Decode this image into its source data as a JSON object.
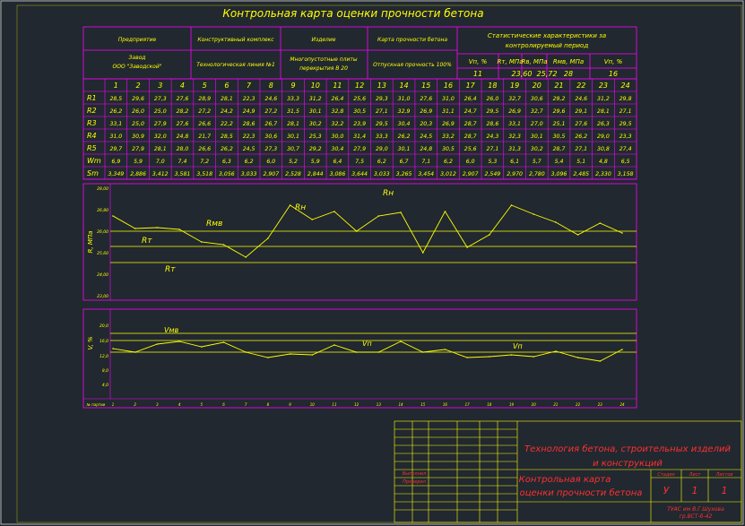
{
  "title": "Контрольная карта оценки прочности бетона",
  "header": {
    "enterprise_label": "Предприятие",
    "enterprise_value_1": "Завод",
    "enterprise_value_2": "ООО \"Заводской\"",
    "structure_label": "Конструктивный комплекс",
    "structure_value": "Технологическая линия №1",
    "product_label": "Изделие",
    "product_value_1": "Многопустотные плиты",
    "product_value_2": "перекрытия В 20",
    "strength_label": "Карта прочности бетона",
    "strength_value": "Отпускная прочность 100%",
    "stat_label_1": "Статистические характеристики за",
    "stat_label_2": "контролируемый период",
    "stat_cols": [
      "Vп, %",
      "Rт, МПа",
      "Rв, МПа",
      "Rмв, МПа",
      "Vп, %"
    ],
    "stat_values": [
      "11",
      "23,60",
      "25,72",
      "28",
      "16"
    ]
  },
  "table": {
    "columns": [
      "1",
      "2",
      "3",
      "4",
      "5",
      "6",
      "7",
      "8",
      "9",
      "10",
      "11",
      "12",
      "13",
      "14",
      "15",
      "16",
      "17",
      "18",
      "19",
      "20",
      "21",
      "22",
      "23",
      "24"
    ],
    "rows": [
      {
        "label": "R1",
        "values": [
          "28,5",
          "29,6",
          "27,3",
          "27,6",
          "28,9",
          "28,1",
          "22,3",
          "24,6",
          "33,3",
          "31,2",
          "26,4",
          "25,6",
          "29,3",
          "31,0",
          "27,6",
          "31,0",
          "26,4",
          "26,0",
          "32,7",
          "30,6",
          "29,2",
          "24,6",
          "31,2",
          "29,8"
        ]
      },
      {
        "label": "R2",
        "values": [
          "26,2",
          "26,0",
          "25,0",
          "28,2",
          "27,2",
          "24,2",
          "24,9",
          "27,2",
          "31,5",
          "30,1",
          "32,8",
          "30,5",
          "27,1",
          "32,9",
          "26,9",
          "31,1",
          "24,7",
          "29,5",
          "26,9",
          "32,7",
          "29,6",
          "29,1",
          "28,1",
          "27,1"
        ]
      },
      {
        "label": "R3",
        "values": [
          "33,1",
          "25,0",
          "27,9",
          "27,6",
          "26,6",
          "22,2",
          "28,6",
          "26,7",
          "28,1",
          "30,2",
          "32,2",
          "23,9",
          "29,5",
          "30,4",
          "20,3",
          "26,9",
          "28,7",
          "28,6",
          "33,1",
          "27,0",
          "25,1",
          "27,6",
          "26,3",
          "29,5"
        ]
      },
      {
        "label": "R4",
        "values": [
          "31,0",
          "30,9",
          "32,0",
          "24,8",
          "21,7",
          "28,5",
          "22,3",
          "30,6",
          "30,1",
          "25,3",
          "30,0",
          "31,4",
          "33,3",
          "26,2",
          "24,5",
          "33,2",
          "28,7",
          "24,3",
          "32,3",
          "30,1",
          "30,5",
          "26,2",
          "29,0",
          "23,3"
        ]
      },
      {
        "label": "R5",
        "values": [
          "29,7",
          "27,9",
          "28,1",
          "28,0",
          "26,6",
          "26,2",
          "24,5",
          "27,3",
          "30,7",
          "29,2",
          "30,4",
          "27,9",
          "29,0",
          "30,1",
          "24,8",
          "30,5",
          "25,6",
          "27,1",
          "31,3",
          "30,2",
          "28,7",
          "27,1",
          "30,8",
          "27,4"
        ]
      },
      {
        "label": "Wm",
        "values": [
          "6,9",
          "5,9",
          "7,0",
          "7,4",
          "7,2",
          "6,3",
          "6,2",
          "6,0",
          "5,2",
          "5,9",
          "6,4",
          "7,5",
          "6,2",
          "6,7",
          "7,1",
          "6,2",
          "6,0",
          "5,3",
          "6,1",
          "5,7",
          "5,4",
          "5,1",
          "4,8",
          "6,5"
        ]
      },
      {
        "label": "Sm",
        "values": [
          "3,349",
          "2,886",
          "3,412",
          "3,581",
          "3,518",
          "3,056",
          "3,033",
          "2,907",
          "2,528",
          "2,844",
          "3,086",
          "3,644",
          "3,033",
          "3,265",
          "3,454",
          "3,012",
          "2,907",
          "2,549",
          "2,970",
          "2,780",
          "3,096",
          "2,485",
          "2,330",
          "3,158"
        ]
      }
    ]
  },
  "chart_r": {
    "ylabel": "R, МПа",
    "ticks": [
      "28,00",
      "26,80",
      "26,00",
      "25,60",
      "24,00",
      "23,00"
    ],
    "label_rmv": "Rмв",
    "label_rt_upper": "Rт",
    "label_rt_lower": "Rт",
    "label_rn": "Rн",
    "label_rn2": "Rн"
  },
  "chart_v": {
    "ylabel": "V, %",
    "ticks": [
      "20,0",
      "16,0",
      "12,0",
      "8,0",
      "4,0"
    ],
    "label_vmv": "Vмв",
    "label_vn": "Vп",
    "label_vn2": "Vп",
    "xaxis_label": "№ партии",
    "xticks": [
      "1",
      "2",
      "3",
      "4",
      "5",
      "6",
      "7",
      "8",
      "9",
      "10",
      "11",
      "12",
      "13",
      "14",
      "15",
      "16",
      "17",
      "18",
      "19",
      "20",
      "21",
      "22",
      "23",
      "24"
    ]
  },
  "chart_data": [
    {
      "type": "line",
      "title": "",
      "ylabel": "R, МПа",
      "x": [
        1,
        2,
        3,
        4,
        5,
        6,
        7,
        8,
        9,
        10,
        11,
        12,
        13,
        14,
        15,
        16,
        17,
        18,
        19,
        20,
        21,
        22,
        23,
        24
      ],
      "series": [
        {
          "name": "",
          "values": [
            25.7,
            25.0,
            25.3,
            25.2,
            24.6,
            24.5,
            23.5,
            24.6,
            27.2,
            26.0,
            26.8,
            25.2,
            26.6,
            26.9,
            23.7,
            26.9,
            23.9,
            24.7,
            27.3,
            26.8,
            26.0,
            25.0,
            25.8,
            25.0
          ]
        }
      ],
      "reference_lines": [
        {
          "label": "Rмв",
          "value": 25.72
        },
        {
          "label": "Rт",
          "value": 24.3
        },
        {
          "label": "Rт",
          "value": 23.6
        }
      ],
      "ylim": [
        23.0,
        28.0
      ]
    },
    {
      "type": "line",
      "title": "",
      "ylabel": "V, %",
      "x": [
        1,
        2,
        3,
        4,
        5,
        6,
        7,
        8,
        9,
        10,
        11,
        12,
        13,
        14,
        15,
        16,
        17,
        18,
        19,
        20,
        21,
        22,
        23,
        24
      ],
      "series": [
        {
          "name": "",
          "values": [
            13.3,
            12.6,
            14.6,
            15.5,
            13.8,
            15.4,
            12.7,
            11.0,
            12.3,
            12.0,
            15.0,
            12.6,
            12.6,
            15.5,
            12.5,
            13.5,
            11.0,
            11.5,
            12.0,
            11.5,
            13.0,
            11.0,
            10.0,
            13.5
          ]
        }
      ],
      "reference_lines": [
        {
          "label": "Vмв",
          "value": 18.0
        },
        {
          "label": "",
          "value": 16.0
        },
        {
          "label": "Vп",
          "value": 12.0
        }
      ],
      "ylim": [
        0,
        21
      ]
    }
  ],
  "stamp": {
    "title_1": "Технология бетона, строительных изделий",
    "title_2": "и конструкций",
    "sheet_1": "Контрольная карта",
    "sheet_2": "оценки прочности бетона",
    "stage_label": "Стадия",
    "sheet_label": "Лист",
    "sheets_label": "Листов",
    "stage_value": "У",
    "sheet_value": "1",
    "sheets_value": "1",
    "org_1": "ТУАС им В.Г.Шухова",
    "org_2": "гр.ВСТ-б-42",
    "developed_label": "Выполнил",
    "checked_label": "Проверил"
  }
}
